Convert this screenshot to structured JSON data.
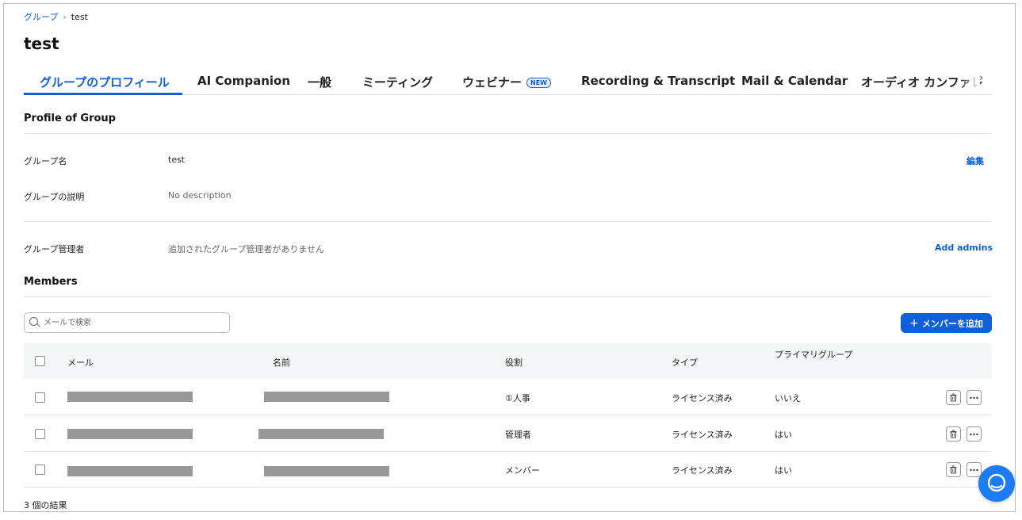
{
  "breadcrumb": {
    "parent": "グループ",
    "sep": "›",
    "current": "test"
  },
  "page": {
    "title": "test"
  },
  "tabs": [
    {
      "label": "グループのプロフィール"
    },
    {
      "label": "AI Companion"
    },
    {
      "label": "一般"
    },
    {
      "label": "ミーティング"
    },
    {
      "label": "ウェビナー",
      "badge": "NEW"
    },
    {
      "label": "Recording & Transcript"
    },
    {
      "label": "Mail & Calendar"
    },
    {
      "label": "オーディオ カンファレ"
    }
  ],
  "tab_arrow": "›",
  "profile": {
    "heading": "Profile of Group",
    "name_label": "グループ名",
    "name_value": "test",
    "edit_link": "編集",
    "desc_label": "グループの説明",
    "desc_value": "No description",
    "admin_label": "グループ管理者",
    "admin_value": "追加されたグループ管理者がありません",
    "add_admins": "Add admins"
  },
  "members": {
    "heading": "Members",
    "search_placeholder": "メールで検索",
    "add_button": "メンバーを追加",
    "add_plus": "+",
    "columns": {
      "email": "メール",
      "name": "名前",
      "role": "役割",
      "type": "タイプ",
      "primary": "プライマリグループ"
    },
    "rows": [
      {
        "role": "①人事",
        "type": "ライセンス済み",
        "primary": "いいえ"
      },
      {
        "role": "管理者",
        "type": "ライセンス済み",
        "primary": "はい"
      },
      {
        "role": "メンバー",
        "type": "ライセンス済み",
        "primary": "はい"
      }
    ],
    "result_count": "3 個の結果"
  },
  "colors": {
    "accent": "#0e5fd8",
    "redaction": "#999999",
    "chat_bubble": "#1d7cf2"
  },
  "icons": [
    "search-icon",
    "trash-icon",
    "more-icon",
    "chat-icon",
    "chevron-right-icon"
  ]
}
